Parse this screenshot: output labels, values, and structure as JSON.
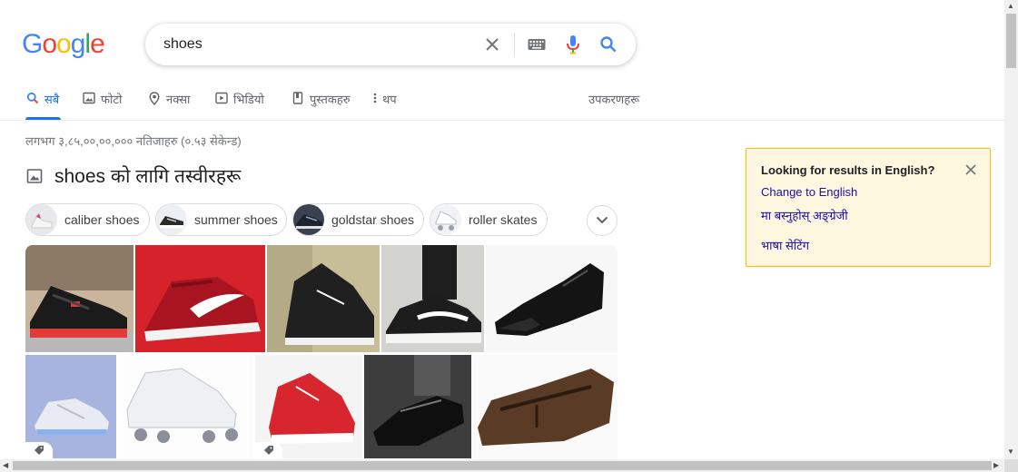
{
  "logo": {
    "letters": [
      "G",
      "o",
      "o",
      "g",
      "l",
      "e"
    ],
    "colors": [
      "#4285f4",
      "#ea4335",
      "#fbbc05",
      "#4285f4",
      "#34a853",
      "#ea4335"
    ]
  },
  "search": {
    "query": "shoes",
    "clear_icon": "close-icon",
    "keyboard_icon": "keyboard-icon",
    "mic_icon": "mic-icon",
    "search_icon": "search-icon"
  },
  "tabs": [
    {
      "label": "सबै",
      "icon": "search-icon",
      "active": true
    },
    {
      "label": "फोटो",
      "icon": "image-icon"
    },
    {
      "label": "नक्सा",
      "icon": "map-pin-icon"
    },
    {
      "label": "भिडियो",
      "icon": "play-icon"
    },
    {
      "label": "पुस्तकहरु",
      "icon": "book-icon"
    },
    {
      "label": "थप",
      "icon": "more-vert-icon"
    }
  ],
  "tools_label": "उपकरणहरू",
  "stats": "लगभग ३,८५,००,००,००० नतिजाहरु (०.५३ सेकेन्ड)",
  "images_heading": "shoes को लागि तस्वीरहरू",
  "chips": [
    "caliber shoes",
    "summer shoes",
    "goldstar shoes",
    "roller skates"
  ],
  "lang_prompt": {
    "question": "Looking for results in English?",
    "change_link": "Change to English",
    "keep_link": "मा बस्नुहोस् अङ्ग्रेजी",
    "settings_link": "भाषा सेटिंग"
  },
  "accent_color": "#1a73e8",
  "link_color": "#1a0dab"
}
